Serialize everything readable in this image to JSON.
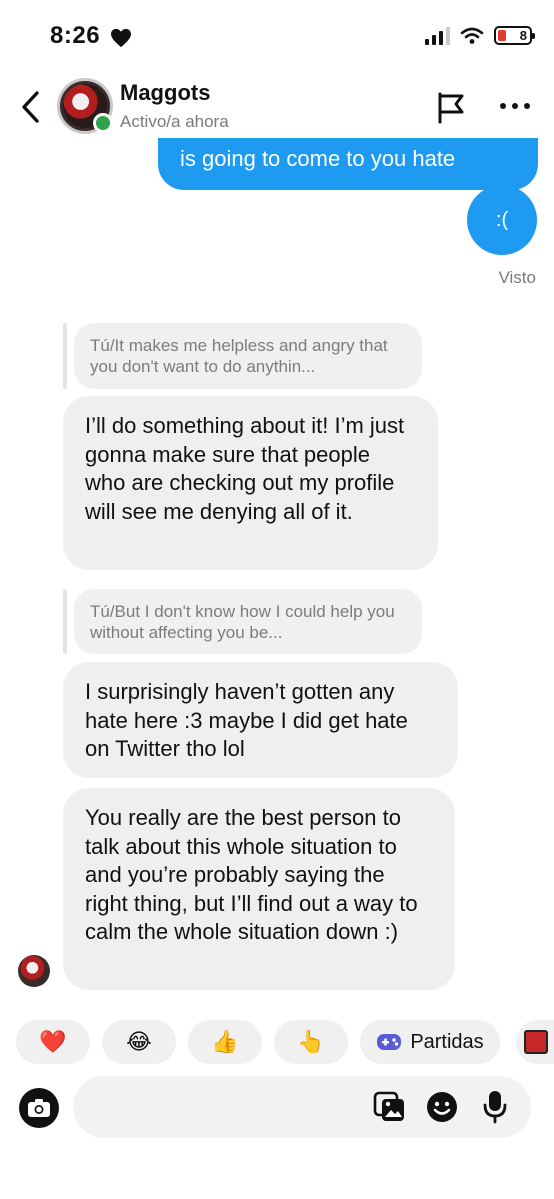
{
  "status_bar": {
    "time": "8:26",
    "heart_icon": "heart-icon",
    "battery_level": "8"
  },
  "header": {
    "contact_name": "Maggots",
    "contact_status": "Activo/a ahora"
  },
  "messages": {
    "outgoing_1": "is going to come to you hate",
    "outgoing_2": ":(",
    "seen_label": "Visto",
    "reply_1": "Tú/It makes me helpless and angry that you don't want to do anythin...",
    "incoming_1": "I’ll do something about it! I’m just gonna make sure that people who are checking out my profile will see me denying all of it.",
    "reply_2": "Tú/But I don't know how I could help you without affecting you be...",
    "incoming_2": "I surprisingly haven’t gotten any hate here :3 maybe I did get hate on Twitter tho lol",
    "incoming_3": "You really are the best person to talk about this whole situation to and you’re probably saying the right thing, but I’ll find out a way to calm the whole situation down :)"
  },
  "reactions": {
    "heart": "❤️",
    "laugh": "😂",
    "thumbs_up": "👍",
    "pointing": "👆",
    "games_label": "Partidas"
  },
  "composer": {
    "placeholder": ""
  },
  "colors": {
    "outgoing_bubble": "#1e9bf0",
    "incoming_bubble": "#efefef",
    "online": "#31a24c"
  }
}
